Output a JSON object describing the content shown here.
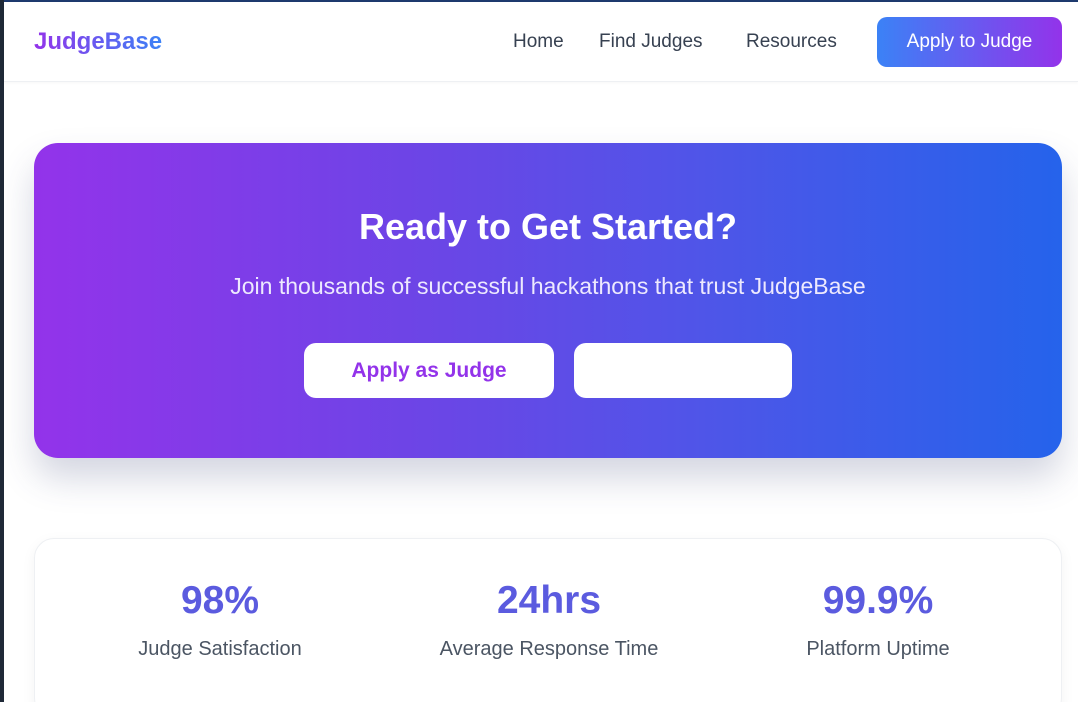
{
  "nav": {
    "logo": "JudgeBase",
    "links": [
      "Home",
      "Find Judges",
      "Resources"
    ],
    "cta": "Apply to Judge"
  },
  "hero": {
    "title": "Ready to Get Started?",
    "subtitle": "Join thousands of successful hackathons that trust JudgeBase",
    "primary_button": "Apply as Judge",
    "secondary_button": ""
  },
  "stats": [
    {
      "value": "98%",
      "label": "Judge Satisfaction"
    },
    {
      "value": "24hrs",
      "label": "Average Response Time"
    },
    {
      "value": "99.9%",
      "label": "Platform Uptime"
    }
  ],
  "colors": {
    "brand_purple": "#9333ea",
    "brand_blue": "#2563eb",
    "stat_value": "#5b5bdf"
  }
}
